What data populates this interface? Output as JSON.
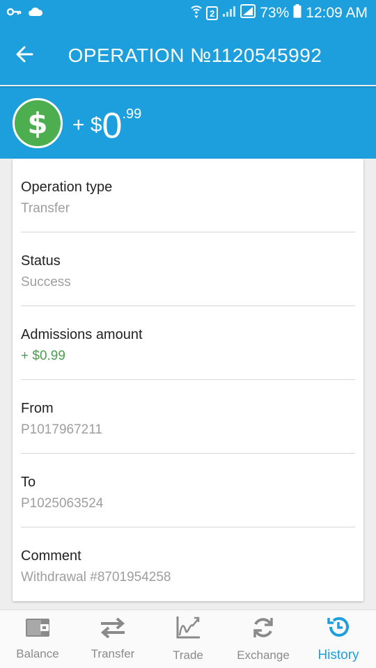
{
  "status_bar": {
    "sim_badge": "2",
    "battery_percent": "73%",
    "time": "12:09 AM"
  },
  "header": {
    "title": "OPERATION №1120545992"
  },
  "amount": {
    "sign": "+ $",
    "whole": "0",
    "cents": ".99",
    "icon_symbol": "$"
  },
  "details": [
    {
      "label": "Operation type",
      "value": "Transfer"
    },
    {
      "label": "Status",
      "value": "Success"
    },
    {
      "label": "Admissions amount",
      "value": "+ $0.99"
    },
    {
      "label": "From",
      "value": "P1017967211"
    },
    {
      "label": "To",
      "value": "P1025063524"
    },
    {
      "label": "Comment",
      "value": "Withdrawal #8701954258"
    }
  ],
  "bottom_nav": [
    {
      "label": "Balance",
      "icon": "wallet-icon"
    },
    {
      "label": "Transfer",
      "icon": "transfer-arrows-icon"
    },
    {
      "label": "Trade",
      "icon": "chart-icon"
    },
    {
      "label": "Exchange",
      "icon": "refresh-icon"
    },
    {
      "label": "History",
      "icon": "history-icon",
      "active": true
    }
  ],
  "colors": {
    "primary": "#1d9fde",
    "success_green": "#4cae4f",
    "value_green": "#4a9e4d",
    "muted_text": "#9e9e9e"
  }
}
